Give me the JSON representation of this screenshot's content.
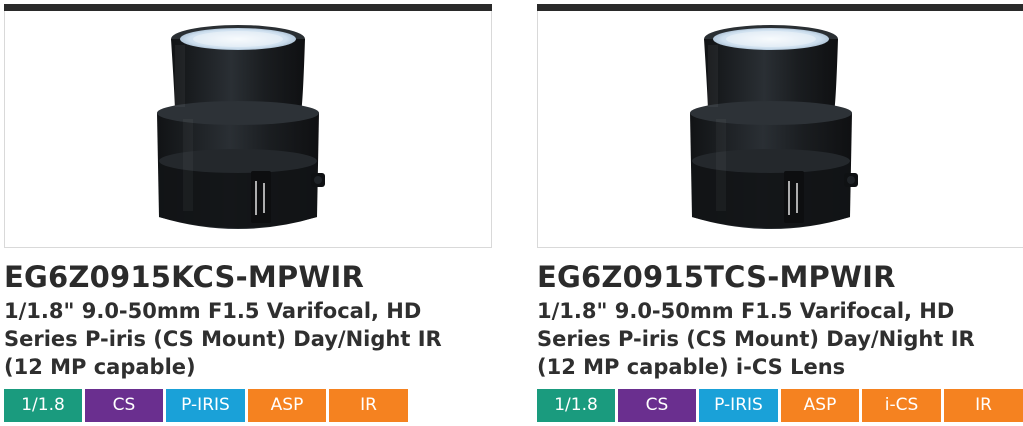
{
  "products": [
    {
      "code": "EG6Z0915KCS-MPWIR",
      "description": "1/1.8\" 9.0-50mm F1.5 Varifocal, HD Series P-iris (CS Mount) Day/Night IR (12 MP capable)",
      "tags": [
        {
          "label": "1/1.8",
          "color": "#1a9b7e"
        },
        {
          "label": "CS",
          "color": "#6a2f8f"
        },
        {
          "label": "P-IRIS",
          "color": "#1aa1d8"
        },
        {
          "label": "ASP",
          "color": "#f58220"
        },
        {
          "label": "IR",
          "color": "#f58220"
        }
      ],
      "image_alt_icon": "lens-product-image"
    },
    {
      "code": "EG6Z0915TCS-MPWIR",
      "description": "1/1.8\" 9.0-50mm F1.5 Varifocal, HD Series P-iris (CS Mount) Day/Night IR (12 MP capable) i-CS Lens",
      "tags": [
        {
          "label": "1/1.8",
          "color": "#1a9b7e"
        },
        {
          "label": "CS",
          "color": "#6a2f8f"
        },
        {
          "label": "P-IRIS",
          "color": "#1aa1d8"
        },
        {
          "label": "ASP",
          "color": "#f58220"
        },
        {
          "label": "i-CS",
          "color": "#f58220"
        },
        {
          "label": "IR",
          "color": "#f58220"
        }
      ],
      "image_alt_icon": "lens-product-image"
    }
  ],
  "colors": {
    "top_bar": "#2a2a2a",
    "frame_border": "#d9d9d9",
    "lens_body": "#1c1f22",
    "lens_glass": "#d7e8f5"
  }
}
